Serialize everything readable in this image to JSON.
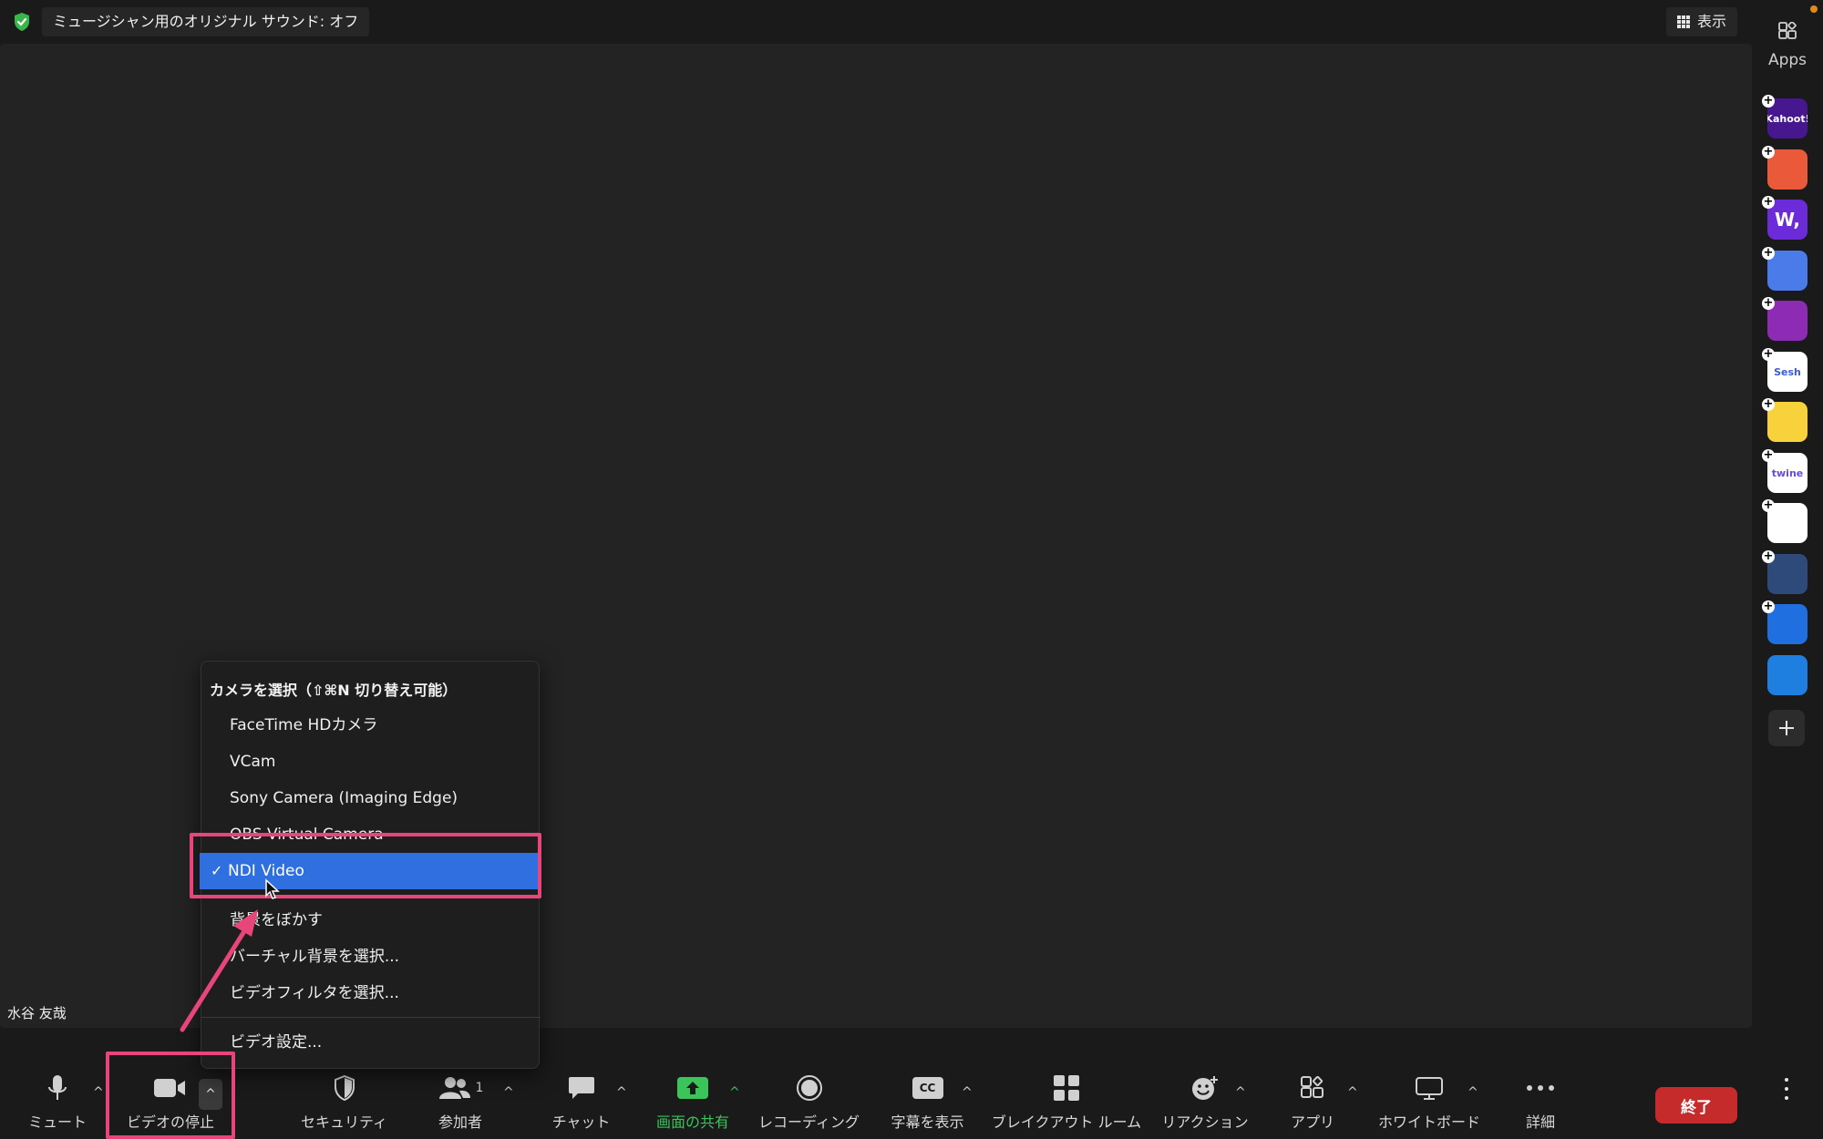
{
  "top_bar": {
    "sound_status": "ミュージシャン用のオリジナル サウンド: オフ",
    "view_label": "表示"
  },
  "video": {
    "participant_name": "水谷 友哉"
  },
  "apps_panel": {
    "label": "Apps",
    "apps": [
      {
        "name": "Kahoot!",
        "text": "Kahoot!",
        "bg": "#46178f",
        "fg": "#ffffff"
      },
      {
        "name": "app-orange",
        "text": "",
        "bg": "#ea5a3a",
        "fg": "#ffffff"
      },
      {
        "name": "Wooclap",
        "text": "W,",
        "bg": "#6b2bd9",
        "fg": "#ffffff"
      },
      {
        "name": "app-cam-blue",
        "text": "",
        "bg": "#4a7be8",
        "fg": "#ffffff"
      },
      {
        "name": "app-purple-rays",
        "text": "",
        "bg": "#8e2bb4",
        "fg": "#ffffff"
      },
      {
        "name": "Sesh",
        "text": "Sesh",
        "bg": "#ffffff",
        "fg": "#3b5bdb"
      },
      {
        "name": "app-emoji",
        "text": "",
        "bg": "#f7d23a",
        "fg": "#333333"
      },
      {
        "name": "twine",
        "text": "twine",
        "bg": "#ffffff",
        "fg": "#6b4ad9"
      },
      {
        "name": "app-blocks",
        "text": "",
        "bg": "#ffffff",
        "fg": "#333333"
      },
      {
        "name": "app-refresh",
        "text": "",
        "bg": "#2d4a7a",
        "fg": "#ffffff"
      },
      {
        "name": "app-flag",
        "text": "",
        "bg": "#1f6fe0",
        "fg": "#ffffff"
      },
      {
        "name": "app-timer",
        "text": "",
        "bg": "#1f7fe0",
        "fg": "#ffffff"
      }
    ]
  },
  "camera_menu": {
    "title": "カメラを選択（⇧⌘N 切り替え可能）",
    "cameras": [
      "FaceTime HDカメラ",
      "VCam",
      "Sony Camera (Imaging Edge)",
      "OBS Virtual Camera",
      "NDI Video"
    ],
    "selected": "NDI Video",
    "check": "✓",
    "options": [
      "背景をぼかす",
      "バーチャル背景を選択...",
      "ビデオフィルタを選択..."
    ],
    "settings": "ビデオ設定..."
  },
  "toolbar": {
    "mute": "ミュート",
    "stop_video": "ビデオの停止",
    "security": "セキュリティ",
    "participants": "参加者",
    "participant_count": "1",
    "chat": "チャット",
    "share_screen": "画面の共有",
    "recording": "レコーディング",
    "captions": "字幕を表示",
    "cc": "CC",
    "breakout": "ブレイクアウト ルーム",
    "reactions": "リアクション",
    "apps": "アプリ",
    "whiteboard": "ホワイトボード",
    "more": "詳細",
    "end": "終了",
    "caret": "^"
  },
  "colors": {
    "accent_share": "#3ac45a",
    "menu_selected": "#2f6fe0",
    "annotation": "#e8467a",
    "end_button": "#c62b2b"
  }
}
